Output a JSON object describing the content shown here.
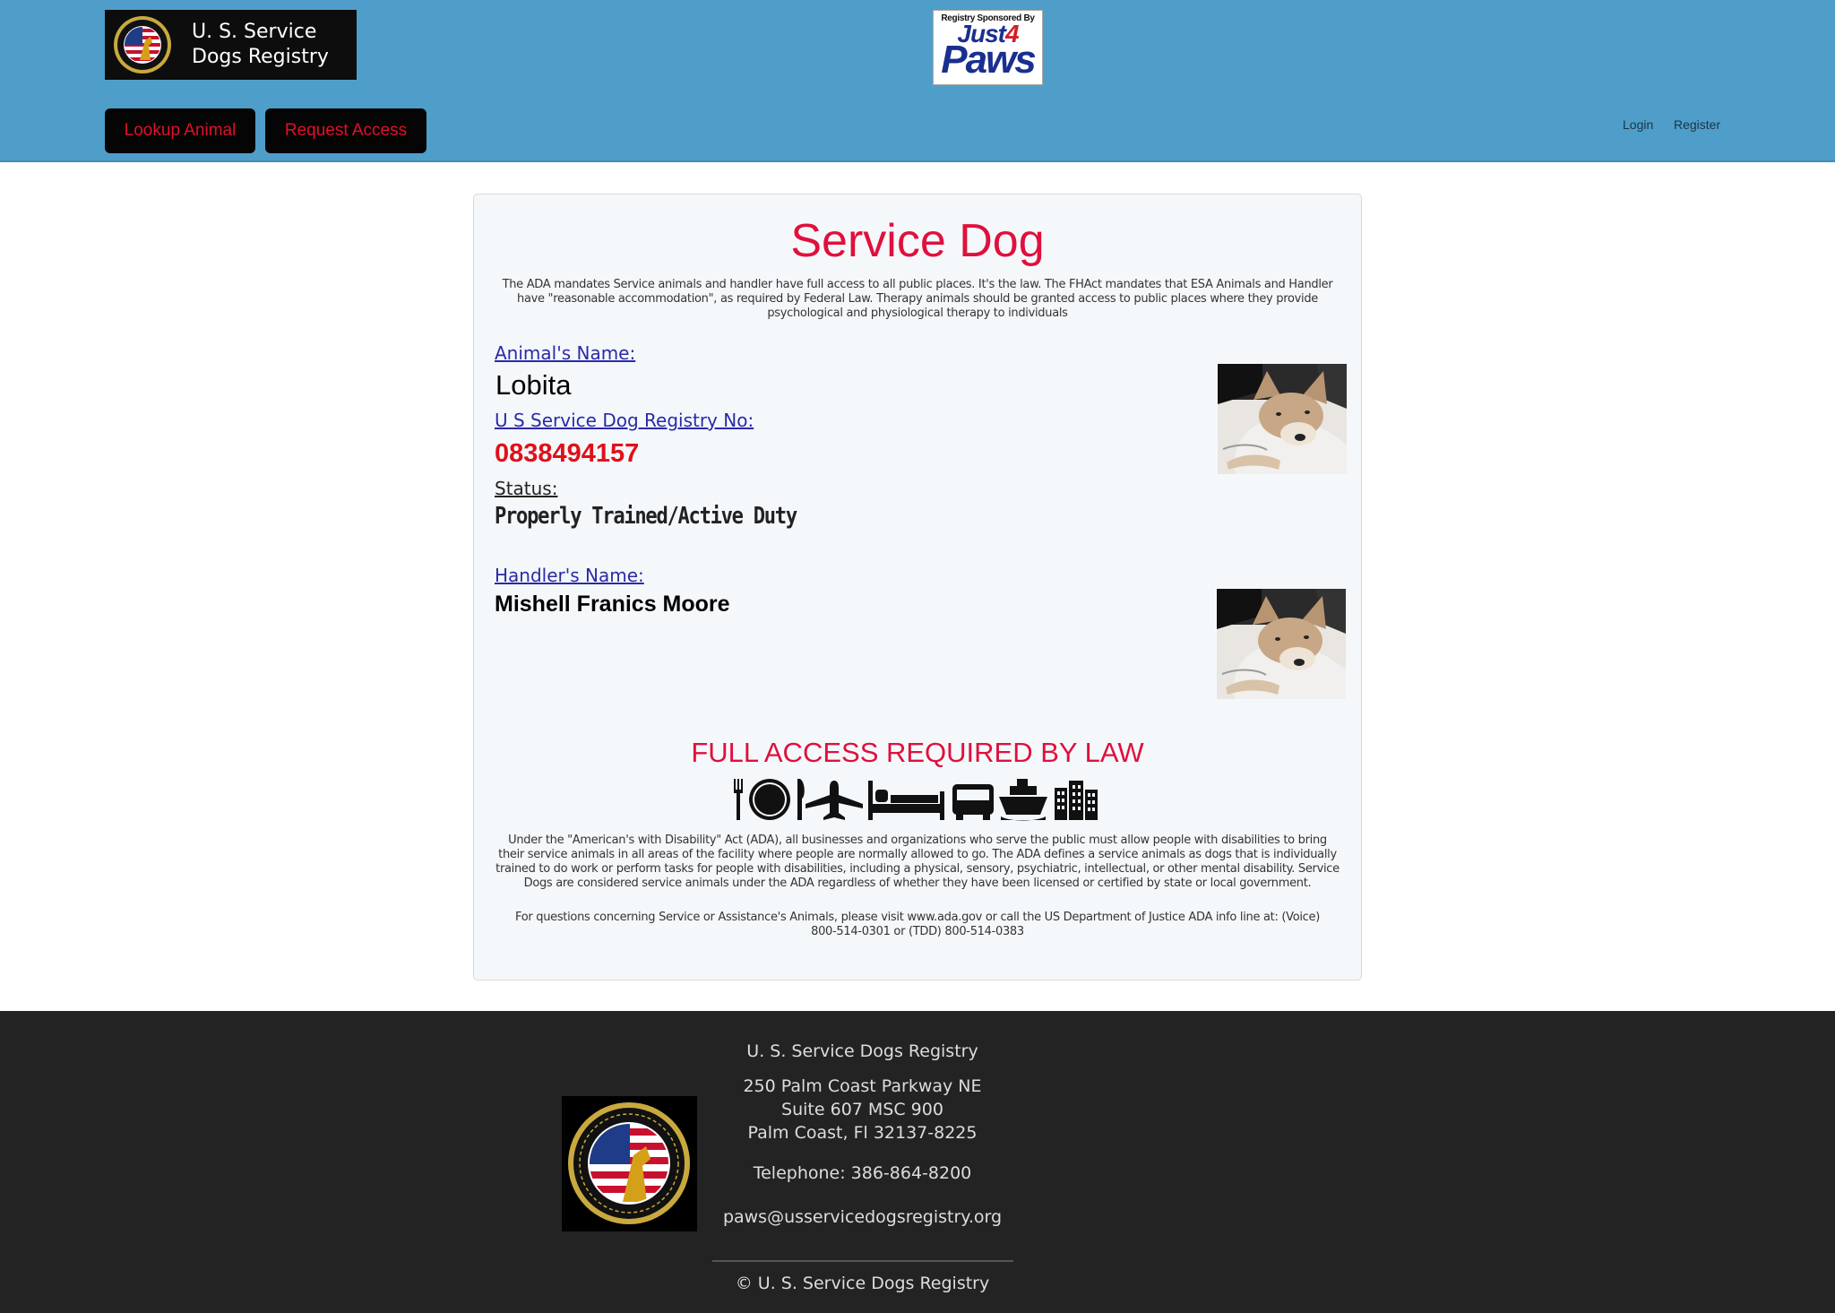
{
  "header": {
    "logo_line1": "U. S. Service",
    "logo_line2": "Dogs Registry",
    "sponsor_top": "Registry Sponsored By",
    "sponsor_just": "Just",
    "sponsor_four": "4",
    "sponsor_paws": "Paws",
    "buttons": {
      "lookup": "Lookup Animal",
      "request": "Request Access"
    },
    "nav": {
      "login": "Login",
      "register": "Register"
    },
    "bg_color": "#4e9ec9",
    "button_text_color": "#e0102a"
  },
  "card": {
    "title": "Service Dog",
    "intro": "The ADA mandates Service animals and handler have full access to all public places. It's the law. The FHAct mandates that ESA Animals and Handler have \"reasonable accommodation\", as required by Federal Law. Therapy animals should be granted access to public places where they provide psychological and physiological therapy to individuals",
    "animal_name_label": "Animal's Name:",
    "animal_name": "Lobita",
    "registry_label": "U S Service Dog Registry No:",
    "registry_no": "0838494157",
    "status_label": "Status:",
    "status": "Properly Trained/Active Duty",
    "handler_label": "Handler's Name:",
    "handler_name": "Mishell Franics Moore",
    "access_heading": "FULL ACCESS REQUIRED BY LAW",
    "access_icons": [
      "dining-icon",
      "airplane-icon",
      "hotel-bed-icon",
      "bus-icon",
      "ship-icon",
      "building-icon"
    ],
    "ada_text": "Under the \"American's with Disability\" Act (ADA), all businesses and organizations who serve the public must allow people with disabilities to bring their service animals in all areas of the facility where people are normally allowed to go. The ADA defines a service animals as dogs that is individually trained to do work or perform tasks for people with disabilities, including a physical, sensory, psychiatric, intellectual, or other mental disability. Service Dogs are considered service animals under the ADA regardless of whether they have been licensed or certified by state or local government.",
    "questions_text": "For questions concerning Service or Assistance's Animals, please visit www.ada.gov or call the US Department of Justice ADA info line at: (Voice) 800-514-0301 or (TDD) 800-514-0383",
    "title_color": "#e0103d"
  },
  "footer": {
    "org_name": "U. S. Service Dogs Registry",
    "address_line1": "250 Palm Coast Parkway NE",
    "address_line2": "Suite 607 MSC 900",
    "address_line3": "Palm Coast, Fl 32137-8225",
    "telephone": "Telephone: 386-864-8200",
    "email": "paws@usservicedogsregistry.org",
    "copyright": "© U. S. Service Dogs Registry",
    "bg_color": "#232323"
  }
}
